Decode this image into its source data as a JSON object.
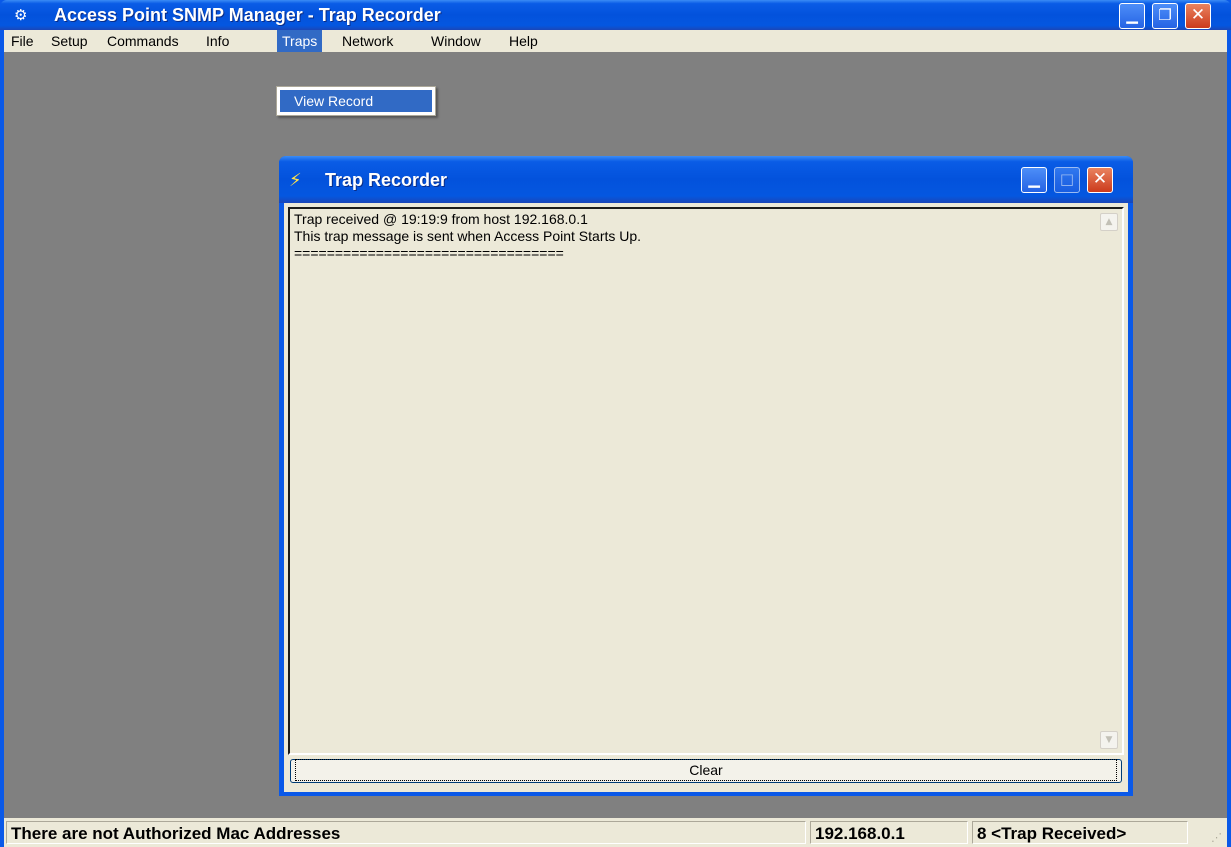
{
  "window": {
    "title": "Access Point SNMP Manager -  Trap Recorder",
    "app_icon": "snmp-app-icon",
    "minimize_glyph": "▁",
    "maximize_glyph": "❐",
    "close_glyph": "✕"
  },
  "menubar": {
    "items": [
      "File",
      "Setup",
      "Commands",
      "Info",
      "Traps",
      "Network",
      "Window",
      "Help"
    ],
    "active": "Traps"
  },
  "dropdown": {
    "items": [
      "View Record"
    ]
  },
  "child_window": {
    "title": "Trap Recorder",
    "icon": "lightning-icon",
    "minimize_glyph": "▁",
    "maximize_glyph": "□",
    "close_glyph": "✕",
    "log_lines": [
      "Trap received @ 19:19:9 from host 192.168.0.1",
      "This trap message is sent when Access Point Starts Up.",
      "================================="
    ],
    "clear_label": "Clear"
  },
  "statusbar": {
    "message": "There are not Authorized Mac Addresses",
    "ip": "192.168.0.1",
    "trap_status": "8 <Trap Received>"
  },
  "colors": {
    "titlebar_blue": "#0352dc",
    "menu_highlight": "#316ac5",
    "mdi_background": "#808080",
    "face": "#ece9d8"
  }
}
